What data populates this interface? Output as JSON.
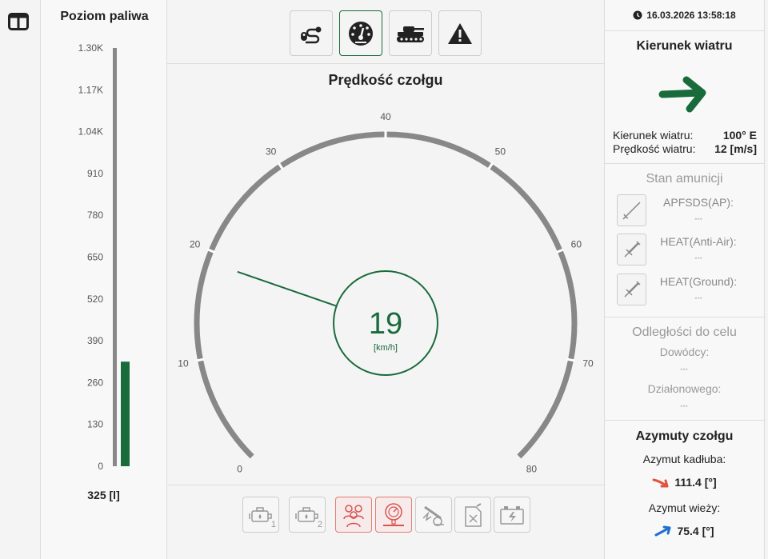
{
  "fuel": {
    "title": "Poziom paliwa",
    "ticks": [
      "1.30K",
      "1.17K",
      "1.04K",
      "910",
      "780",
      "650",
      "520",
      "390",
      "260",
      "130",
      "0"
    ],
    "value_label": "325 [l]",
    "level": 325,
    "max": 1300,
    "bar_color": "#1a6b3c"
  },
  "tabs": [
    {
      "icon": "route-icon"
    },
    {
      "icon": "speedometer-icon",
      "active": true
    },
    {
      "icon": "tank-icon"
    },
    {
      "icon": "warning-icon"
    }
  ],
  "speed": {
    "title": "Prędkość czołgu",
    "value": "19",
    "unit": "[km/h]",
    "numeric": 19,
    "min": 0,
    "max": 80,
    "ticks": [
      "0",
      "10",
      "20",
      "30",
      "40",
      "50",
      "60",
      "70",
      "80"
    ],
    "accent": "#1a6b3c"
  },
  "status_icons": [
    {
      "icon": "engine-1-icon",
      "sub": "1",
      "alert": false
    },
    {
      "icon": "engine-2-icon",
      "sub": "2",
      "alert": false
    },
    {
      "icon": "crew-icon",
      "sub": "",
      "alert": true
    },
    {
      "icon": "pressure-icon",
      "sub": "",
      "alert": true
    },
    {
      "icon": "artillery-icon",
      "sub": "",
      "alert": false
    },
    {
      "icon": "fuel-can-icon",
      "sub": "",
      "alert": false
    },
    {
      "icon": "battery-icon",
      "sub": "",
      "alert": false
    }
  ],
  "datetime": "16.03.2026 13:58:18",
  "wind": {
    "title": "Kierunek wiatru",
    "direction_label": "Kierunek wiatru:",
    "direction_value": "100° E",
    "speed_label": "Prędkość wiatru:",
    "speed_value": "12 [m/s]",
    "arrow_color": "#1a6b3c"
  },
  "ammo": {
    "title": "Stan amunicji",
    "items": [
      {
        "label": "APFSDS(AP):",
        "value": "•••"
      },
      {
        "label": "HEAT(Anti-Air):",
        "value": "•••"
      },
      {
        "label": "HEAT(Ground):",
        "value": "•••"
      }
    ]
  },
  "target": {
    "title": "Odległości do celu",
    "commander_label": "Dowódcy:",
    "commander_value": "•••",
    "gunner_label": "Działonowego:",
    "gunner_value": "•••"
  },
  "azimuth": {
    "title": "Azymuty czołgu",
    "hull_label": "Azymut kadłuba:",
    "hull_value": "111.4 [°]",
    "hull_color": "#e0533d",
    "turret_label": "Azymut wieży:",
    "turret_value": "75.4 [°]",
    "turret_color": "#1f6fd1"
  }
}
